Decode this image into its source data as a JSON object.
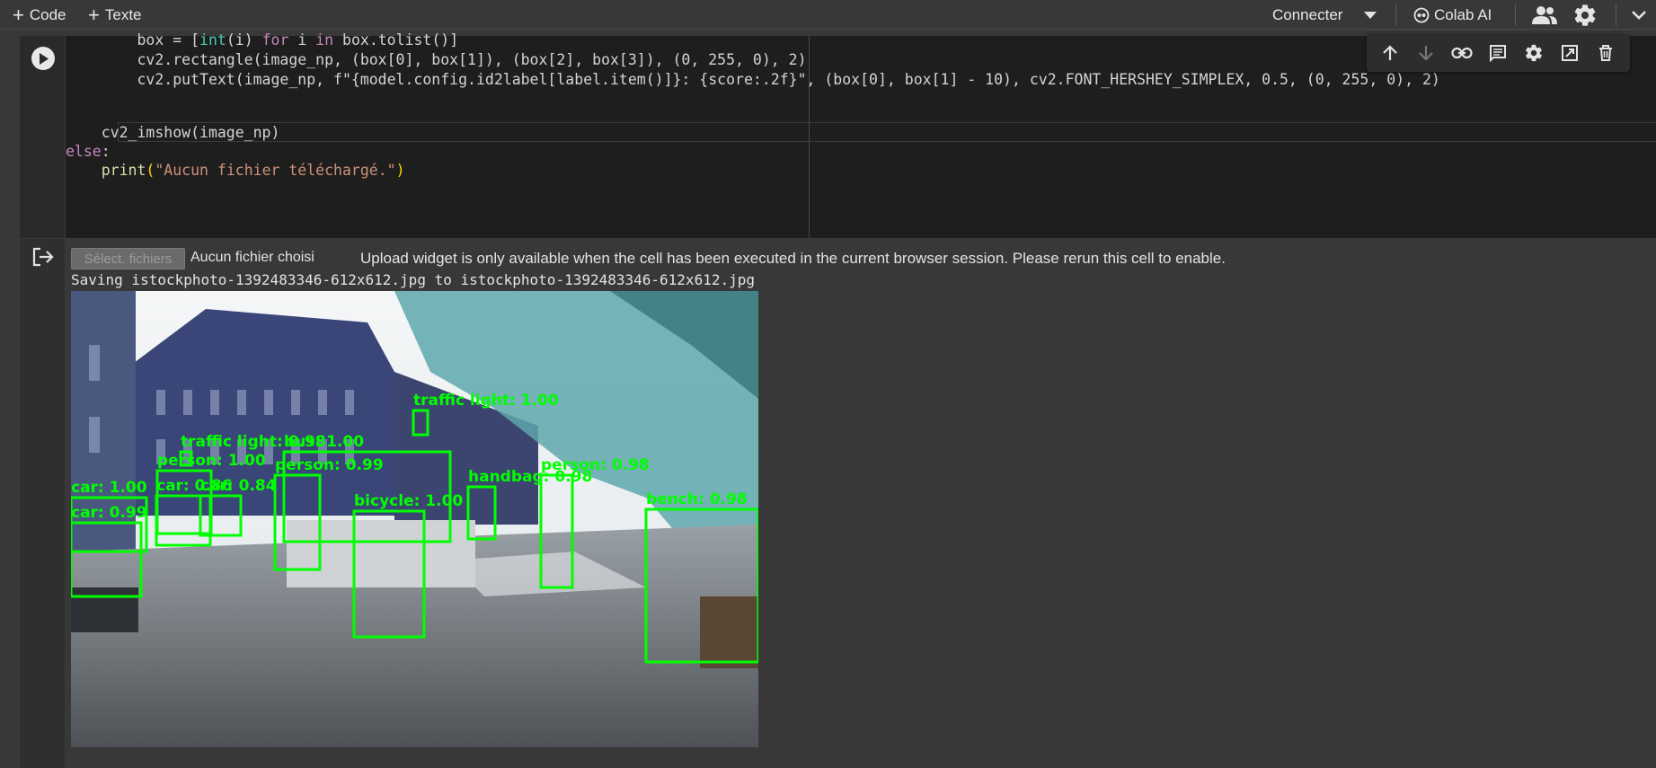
{
  "toolbar": {
    "code_label": "Code",
    "text_label": "Texte",
    "connect_label": "Connecter",
    "colab_ai_label": "Colab AI"
  },
  "code_lines": {
    "l1_a": "        box = [",
    "l1_b": "int",
    "l1_c": "(i) ",
    "l1_d": "for",
    "l1_e": " i ",
    "l1_f": "in",
    "l1_g": " box.tolist()]",
    "l2": "        cv2.rectangle(image_np, (box[0], box[1]), (box[2], box[3]), (0, 255, 0), 2)",
    "l3": "        cv2.putText(image_np, f\"{model.config.id2label[label.item()]}: {score:.2f}\", (box[0], box[1] - 10), cv2.FONT_HERSHEY_SIMPLEX, 0.5, (0, 255, 0), 2)",
    "l5": "    cv2_imshow(image_np)",
    "l6_a": "else",
    "l6_b": ":",
    "l7_a": "    ",
    "l7_b": "print",
    "l7_c": "(",
    "l7_d": "\"Aucun fichier téléchargé.\"",
    "l7_e": ")"
  },
  "output": {
    "file_button_label": "Sélect. fichiers",
    "no_file_text": "Aucun fichier choisi",
    "upload_message": "Upload widget is only available when the cell has been executed in the current browser session. Please rerun this cell to enable.",
    "saving_text": "Saving istockphoto-1392483346-612x612.jpg to istockphoto-1392483346-612x612.jpg"
  },
  "detections": [
    {
      "label": "traffic light: 1.00"
    },
    {
      "label": "traffic light: 0.98"
    },
    {
      "label": "bus: 1.00"
    },
    {
      "label": "person: 1.00"
    },
    {
      "label": "person: 0.99"
    },
    {
      "label": "person: 0.98"
    },
    {
      "label": "car: 1.00"
    },
    {
      "label": "car: 0.99"
    },
    {
      "label": "car: 0.86"
    },
    {
      "label": "car: 0.84"
    },
    {
      "label": "bicycle: 1.00"
    },
    {
      "label": "handbag: 0.98"
    },
    {
      "label": "bench: 0.98"
    }
  ],
  "colors": {
    "background": "#383838",
    "editor": "#1e1e1e",
    "detection_box": "#00ff00"
  }
}
